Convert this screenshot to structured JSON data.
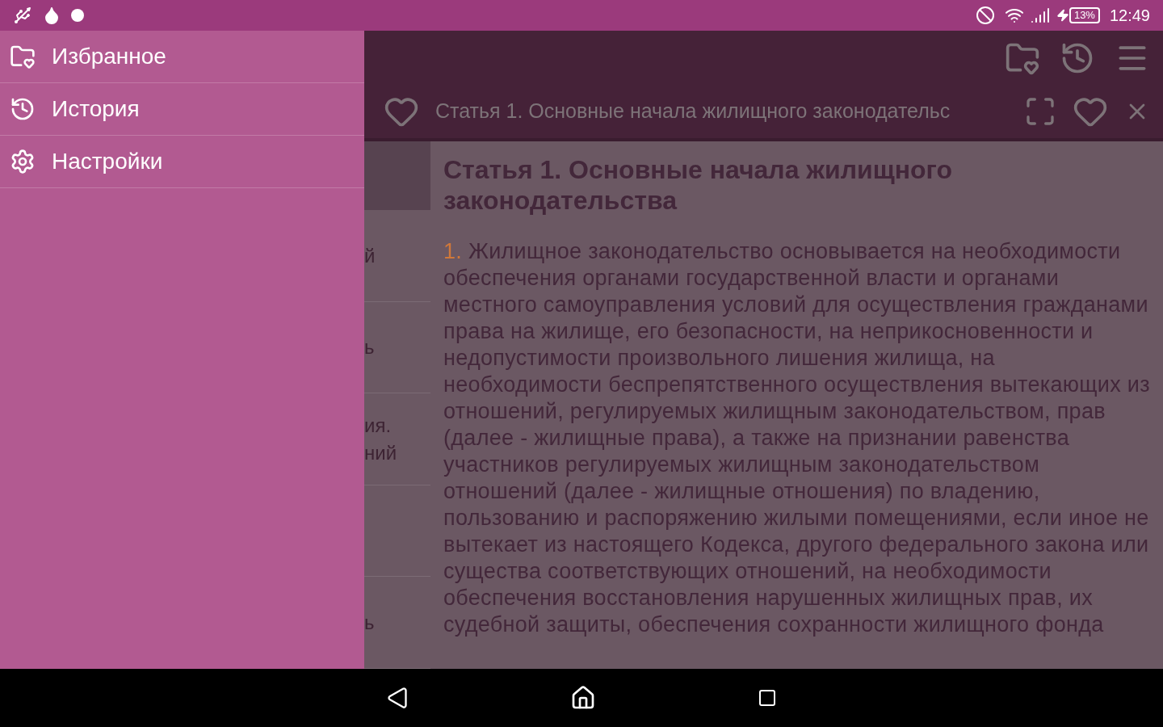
{
  "status_bar": {
    "time": "12:49",
    "battery": "13%"
  },
  "drawer": {
    "items": [
      {
        "kind": "favorites",
        "label": "Избранное"
      },
      {
        "kind": "history",
        "label": "История"
      },
      {
        "kind": "settings",
        "label": "Настройки"
      }
    ]
  },
  "tab": {
    "title": "Статья 1. Основные начала жилищного законодательс"
  },
  "article_list": [
    {
      "selected": true
    },
    {
      "selected": false,
      "lines": [
        "й"
      ]
    },
    {
      "selected": false,
      "lines": [
        "ь"
      ]
    },
    {
      "selected": false,
      "lines": [
        "ия.",
        "ний"
      ]
    },
    {
      "selected": false
    },
    {
      "selected": false,
      "lines": [
        "ь"
      ]
    }
  ],
  "article": {
    "heading": "Статья 1. Основные начала жилищного законодательства",
    "number": "1.",
    "text": "Жилищное законодательство основывается на необходимости обеспечения органами государственной власти и органами местного самоуправления условий для осуществления гражданами права на жилище, его безопасности, на неприкосновенности и недопустимости произвольного лишения жилища, на необходимости беспрепятственного осуществления вытекающих из отношений, регулируемых жилищным законодательством, прав (далее - жилищные права), а также на признании равенства участников регулируемых жилищным законодательством отношений (далее - жилищные отношения) по владению, пользованию и распоряжению жилыми помещениями, если иное не вытекает из настоящего Кодекса, другого федерального закона или существа соответствующих отношений, на необходимости обеспечения восстановления нарушенных жилищных прав, их судебной защиты, обеспечения сохранности жилищного фонда"
  }
}
